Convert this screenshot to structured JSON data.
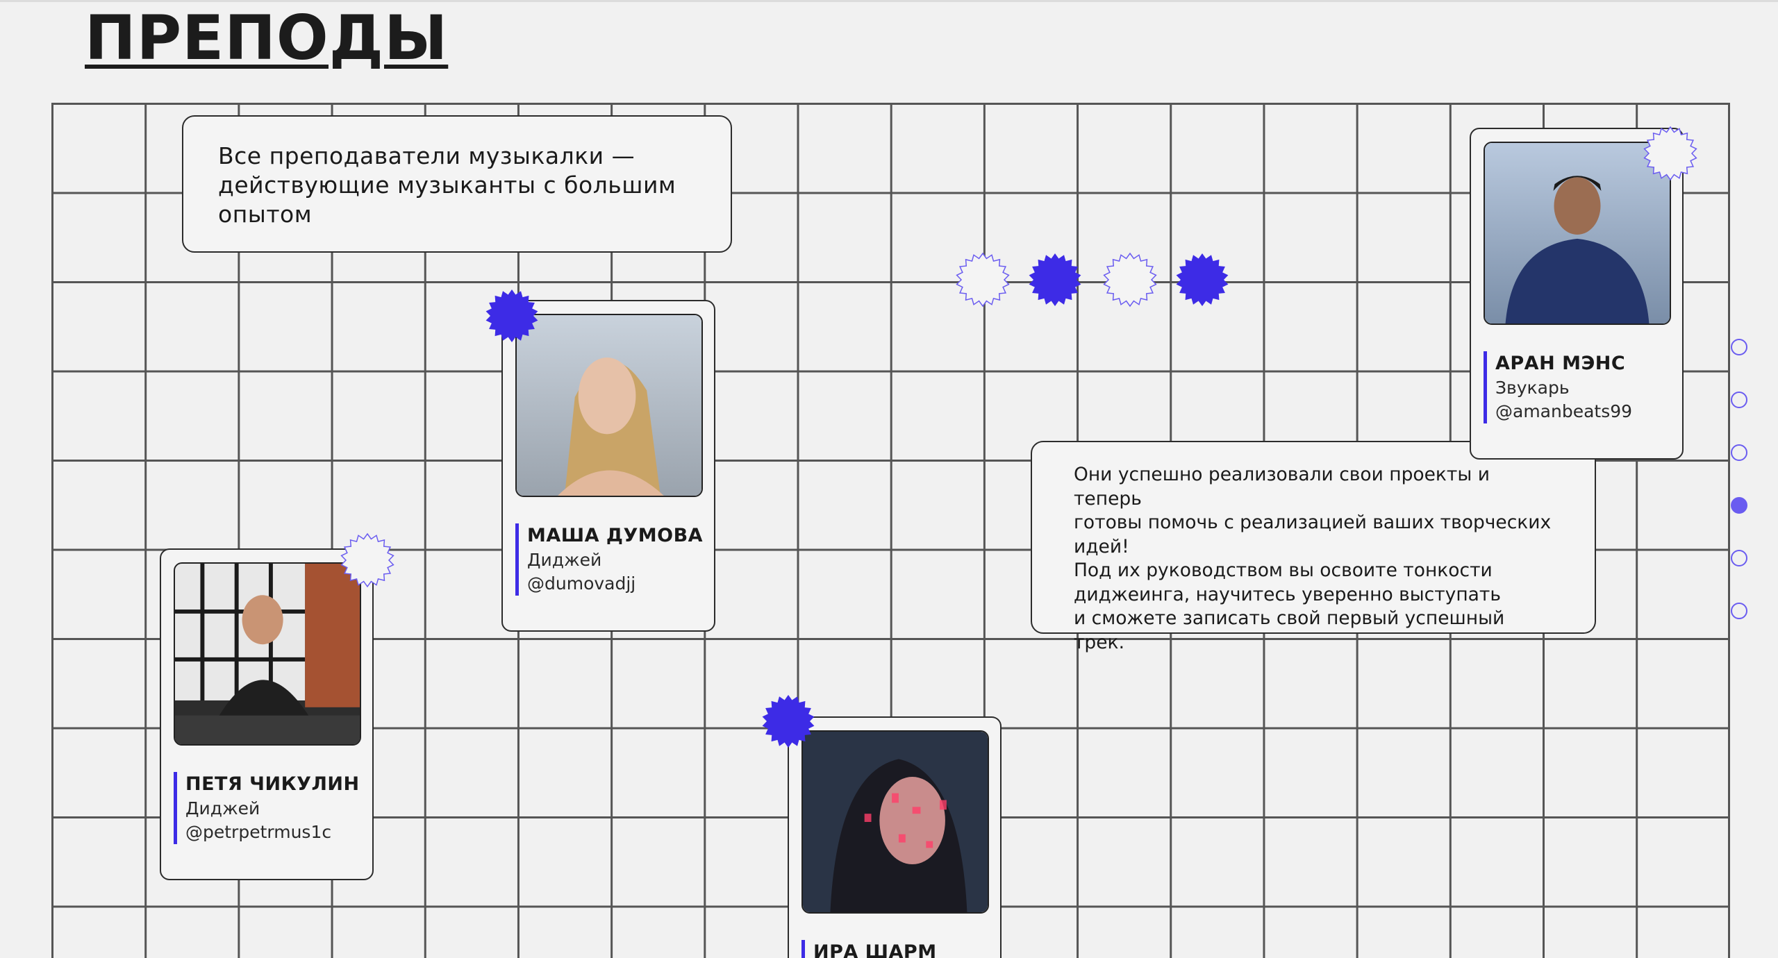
{
  "page": {
    "title": "ПРЕПОДЫ",
    "accent": "#3d2be6",
    "intro": "Все преподаватели музыкалки — действующие музыканты с большим опытом",
    "description_lines": [
      "Они успешно реализовали свои проекты и теперь",
      "готовы помочь с реализацией ваших творческих",
      "идей!",
      "Под их руководством вы освоите тонкости",
      "диджеинга, научитесь уверенно выступать",
      "и сможете записать свой первый успешный трек."
    ]
  },
  "teachers": [
    {
      "name": "МАША ДУМОВА",
      "role": "Диджей",
      "handle": "@dumovadjj"
    },
    {
      "name": "ПЕТЯ ЧИКУЛИН",
      "role": "Диджей",
      "handle": "@petrpetrmus1c"
    },
    {
      "name": "АРАН МЭНС",
      "role": "Звукарь",
      "handle": "@amanbeats99"
    },
    {
      "name": "ИРА ШАРМ",
      "role": "",
      "handle": ""
    }
  ],
  "icons": {
    "badge_filled": "starburst-filled-icon",
    "badge_outline": "starburst-outline-icon"
  },
  "nav": {
    "dots": 6,
    "active_index": 3
  }
}
